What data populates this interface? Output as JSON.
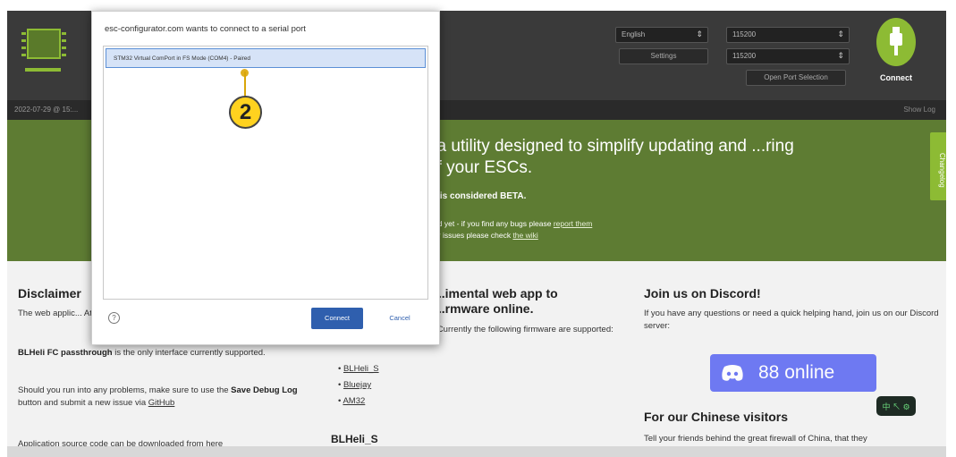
{
  "header": {
    "language_select": "English",
    "baud_select": "115200",
    "settings_label": "Settings",
    "baud2_select": "115200",
    "open_port_label": "Open Port Selection",
    "connect_label": "Connect"
  },
  "logbar": {
    "log_text": "2022-07-29 @ 15:...",
    "show_log": "Show Log"
  },
  "hero": {
    "headline": ", a utility designed to simplify updating and ...ring of your ESCs.",
    "beta": "...l is considered BETA.",
    "note_line1_prefix": "...ed yet - if you find any bugs please ",
    "note_line1_link": "report them",
    "note_line2_prefix": "...er issues please check ",
    "note_line2_link": "the wiki",
    "changelog": "Changelog"
  },
  "disclaimer": {
    "title": "Disclaimer",
    "text1": "The web applic... Atmel, BLHeli f...",
    "bold1": "BLHeli FC passthrough",
    "text2": " is the only interface currently supported.",
    "text3": "Should you run into any problems, make sure to use the ",
    "bold2": "Save Debug Log",
    "text4": " button and submit a new issue via ",
    "link": "GitHub",
    "text5": "Application source code can be downloaded from ",
    "link2": "here"
  },
  "middle": {
    "title": "...imental web app to ...rmware online.",
    "text1": "...latest stable version here. Currently the following firmware are supported:",
    "firmware": [
      "BLHeli_S",
      "Bluejay",
      "AM32"
    ],
    "section2": "BLHeli_S"
  },
  "discord": {
    "title": "Join us on Discord!",
    "text": "If you have any questions or need a quick helping hand, join us on our Discord server:",
    "online": "88 online"
  },
  "chinese": {
    "title": "For our Chinese visitors",
    "text": "Tell your friends behind the great firewall of China, that they"
  },
  "dialog": {
    "title": "esc-configurator.com wants to connect to a serial port",
    "device": "STM32 Virtual ComPort in FS Mode (COM4) - Paired",
    "connect": "Connect",
    "cancel": "Cancel"
  },
  "marker": {
    "number": "2"
  },
  "chat": {
    "label": "中 ↖ ⚙"
  },
  "colors": {
    "green_brand": "#5e7c33",
    "accent_green": "#8dbb34",
    "header_dark": "#3a3a3a",
    "discord": "#5865f2",
    "dialog_blue": "#2f5fae",
    "marker_yellow": "#ffd21f"
  }
}
